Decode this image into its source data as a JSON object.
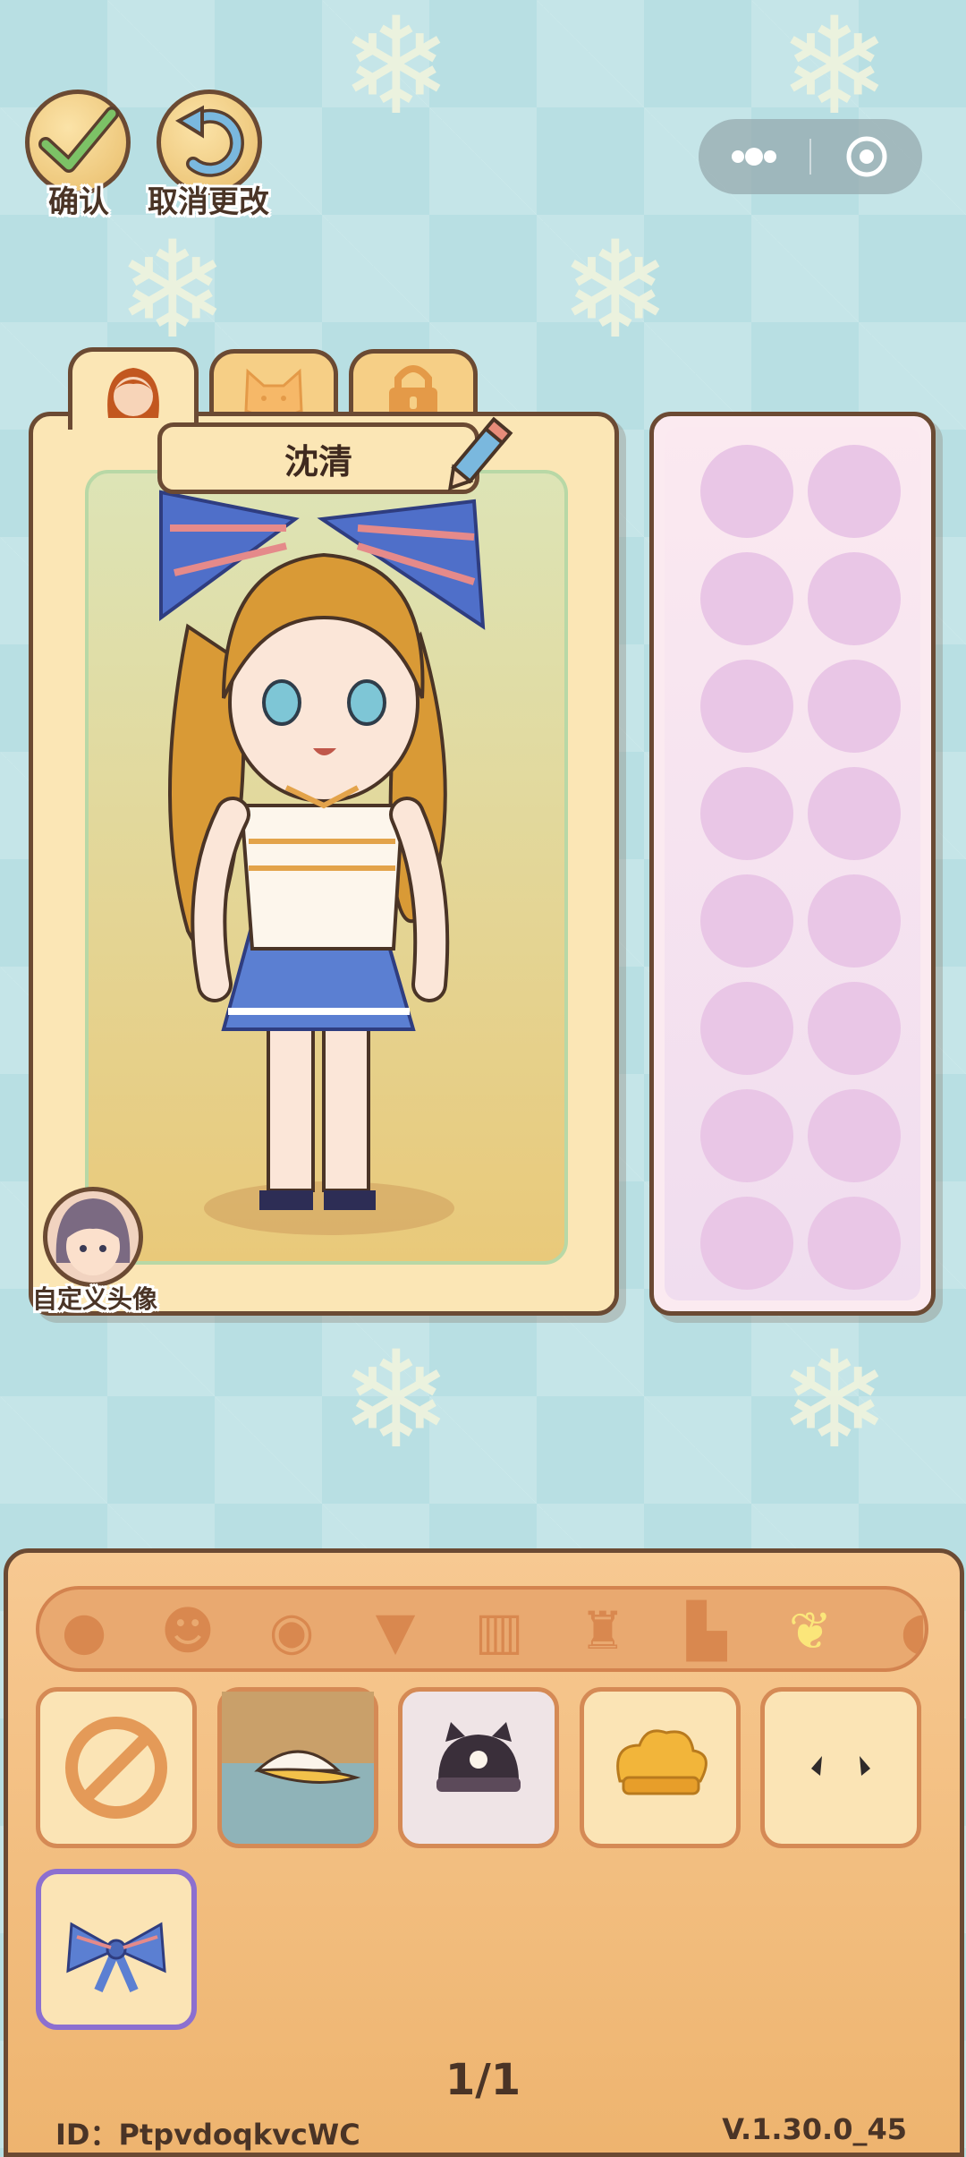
{
  "top_actions": {
    "confirm_label": "确认",
    "cancel_label": "取消更改"
  },
  "character": {
    "name": "沈清",
    "custom_avatar_label": "自定义头像"
  },
  "pagination": {
    "text": "1/1"
  },
  "footer": {
    "id_text": "ID：PtpvdoqkvcWC",
    "version": "V.1.30.0_45"
  },
  "colors": {
    "accent_selected": "#8c6fd0"
  }
}
